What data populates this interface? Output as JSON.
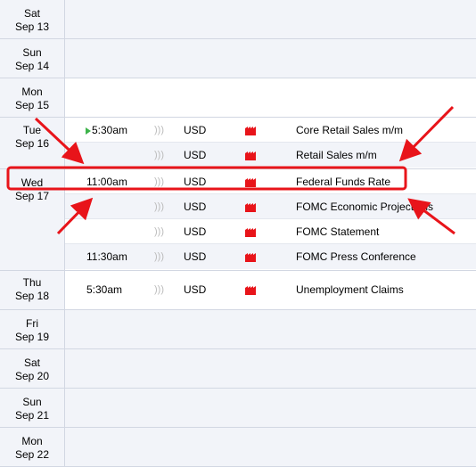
{
  "days": [
    {
      "dow": "Sat",
      "date": "Sep 13"
    },
    {
      "dow": "Sun",
      "date": "Sep 14"
    },
    {
      "dow": "Mon",
      "date": "Sep 15"
    },
    {
      "dow": "Tue",
      "date": "Sep 16"
    },
    {
      "dow": "Wed",
      "date": "Sep 17"
    },
    {
      "dow": "Thu",
      "date": "Sep 18"
    },
    {
      "dow": "Fri",
      "date": "Sep 19"
    },
    {
      "dow": "Sat",
      "date": "Sep 20"
    },
    {
      "dow": "Sun",
      "date": "Sep 21"
    },
    {
      "dow": "Mon",
      "date": "Sep 22"
    }
  ],
  "events": [
    {
      "time": "5:30am",
      "currency": "USD",
      "name": "Core Retail Sales m/m",
      "impact_icon": "factory-icon",
      "playing": true
    },
    {
      "time": "",
      "currency": "USD",
      "name": "Retail Sales m/m",
      "impact_icon": "factory-icon"
    },
    {
      "time": "11:00am",
      "currency": "USD",
      "name": "Federal Funds Rate",
      "impact_icon": "factory-icon"
    },
    {
      "time": "",
      "currency": "USD",
      "name": "FOMC Economic Projections",
      "impact_icon": "factory-icon"
    },
    {
      "time": "",
      "currency": "USD",
      "name": "FOMC Statement",
      "impact_icon": "factory-icon"
    },
    {
      "time": "11:30am",
      "currency": "USD",
      "name": "FOMC Press Conference",
      "impact_icon": "factory-icon"
    },
    {
      "time": "5:30am",
      "currency": "USD",
      "name": "Unemployment Claims",
      "impact_icon": "factory-icon"
    }
  ],
  "colors": {
    "highlight": "#e8141a",
    "impact_high": "#e8141a",
    "playing": "#3cb34a",
    "row_shade": "#f2f4f9"
  }
}
